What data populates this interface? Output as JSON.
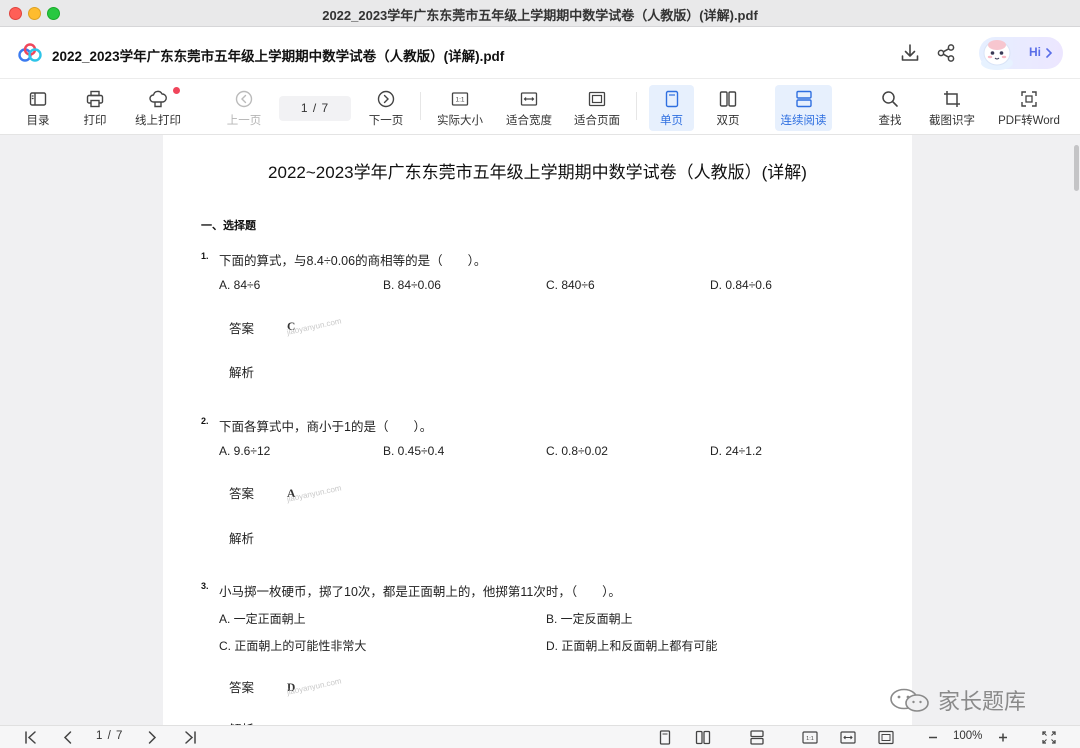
{
  "window": {
    "title": "2022_2023学年广东东莞市五年级上学期期中数学试卷（人教版）(详解).pdf"
  },
  "header": {
    "doc_title": "2022_2023学年广东东莞市五年级上学期期中数学试卷（人教版）(详解).pdf",
    "download_icon": "download-icon",
    "share_icon": "share-icon",
    "ai_label": "Hi"
  },
  "toolbar": {
    "toc": "目录",
    "print": "打印",
    "online_print": "线上打印",
    "prev": "上一页",
    "page_indicator": "1  /  7",
    "next": "下一页",
    "actual_size": "实际大小",
    "fit_width": "适合宽度",
    "fit_page": "适合页面",
    "single_page": "单页",
    "double_page": "双页",
    "continuous": "连续阅读",
    "search": "查找",
    "ocr": "截图识字",
    "pdf_to_word": "PDF转Word",
    "accent_color": "#2f6fe0"
  },
  "document": {
    "title": "2022~2023学年广东东莞市五年级上学期期中数学试卷（人教版）(详解)",
    "section": "一、选择题",
    "answer_label": "答案",
    "analysis_label": "解析",
    "watermark": "jiaoyanyun.com",
    "questions": [
      {
        "num": "1.",
        "text": "下面的算式，与8.4÷0.06的商相等的是（　　）。",
        "options": [
          "A. 84÷6",
          "B. 84÷0.06",
          "C. 840÷6",
          "D. 0.84÷0.6"
        ],
        "answer": "C"
      },
      {
        "num": "2.",
        "text": "下面各算式中，商小于1的是（　　）。",
        "options": [
          "A. 9.6÷12",
          "B. 0.45÷0.4",
          "C. 0.8÷0.02",
          "D. 24÷1.2"
        ],
        "answer": "A"
      },
      {
        "num": "3.",
        "text": "小马掷一枚硬币，掷了10次，都是正面朝上的，他掷第11次时，（　　）。",
        "options": [
          "A. 一定正面朝上",
          "B. 一定反面朝上",
          "C. 正面朝上的可能性非常大",
          "D. 正面朝上和反面朝上都有可能"
        ],
        "answer": "D"
      }
    ],
    "partial_analysis": "解析"
  },
  "corner_watermark": "家长题库",
  "statusbar": {
    "page_indicator": "1  /  7",
    "zoom": "100%"
  }
}
